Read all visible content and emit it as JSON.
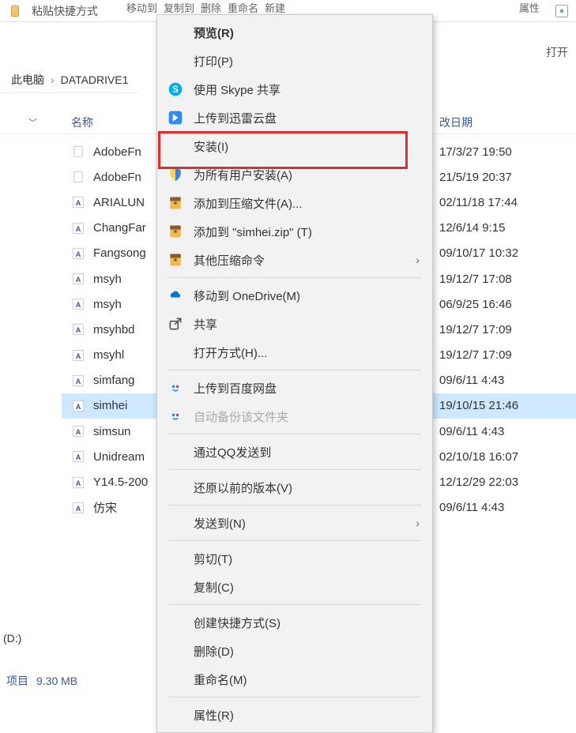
{
  "toolbar": {
    "paste_shortcut": "粘贴快捷方式",
    "move_to": "移动到",
    "copy_to": "复制到",
    "delete": "删除",
    "rename": "重命名",
    "new": "新建",
    "properties": "属性",
    "open": "打开"
  },
  "breadcrumb": {
    "this_pc": "此电脑",
    "drive": "DATADRIVE1"
  },
  "columns": {
    "name": "名称",
    "date": "改日期"
  },
  "sidebar": {
    "drive_label": "(D:)"
  },
  "files": [
    {
      "name": "AdobeFn",
      "date": "17/3/27 19:50",
      "type": "generic"
    },
    {
      "name": "AdobeFn",
      "date": "21/5/19 20:37",
      "type": "generic"
    },
    {
      "name": "ARIALUN",
      "date": "02/11/18 17:44",
      "type": "font"
    },
    {
      "name": "ChangFar",
      "date": "12/6/14 9:15",
      "type": "font"
    },
    {
      "name": "Fangsong",
      "date": "09/10/17 10:32",
      "type": "font"
    },
    {
      "name": "msyh",
      "date": "19/12/7 17:08",
      "type": "font"
    },
    {
      "name": "msyh",
      "date": "06/9/25 16:46",
      "type": "font"
    },
    {
      "name": "msyhbd",
      "date": "19/12/7 17:09",
      "type": "font"
    },
    {
      "name": "msyhl",
      "date": "19/12/7 17:09",
      "type": "font"
    },
    {
      "name": "simfang",
      "date": "09/6/11 4:43",
      "type": "font"
    },
    {
      "name": "simhei",
      "date": "19/10/15 21:46",
      "type": "font",
      "selected": true
    },
    {
      "name": "simsun",
      "date": "09/6/11 4:43",
      "type": "font"
    },
    {
      "name": "Unidream",
      "date": "02/10/18 16:07",
      "type": "font"
    },
    {
      "name": "Y14.5-200",
      "date": "12/12/29 22:03",
      "type": "font"
    },
    {
      "name": "仿宋",
      "date": "09/6/11 4:43",
      "type": "font"
    }
  ],
  "menu": {
    "items": [
      {
        "label": "预览(R)",
        "icon": "",
        "bold": true
      },
      {
        "label": "打印(P)",
        "icon": ""
      },
      {
        "label": "使用 Skype 共享",
        "icon": "skype"
      },
      {
        "label": "上传到迅雷云盘",
        "icon": "xunlei"
      },
      {
        "label": "安装(I)",
        "icon": ""
      },
      {
        "label": "为所有用户安装(A)",
        "icon": "shield"
      },
      {
        "label": "添加到压缩文件(A)...",
        "icon": "archive"
      },
      {
        "label": "添加到 \"simhei.zip\" (T)",
        "icon": "archive"
      },
      {
        "label": "其他压缩命令",
        "icon": "archive",
        "submenu": true
      },
      {
        "sep": true
      },
      {
        "label": "移动到 OneDrive(M)",
        "icon": "onedrive"
      },
      {
        "label": "共享",
        "icon": "share"
      },
      {
        "label": "打开方式(H)...",
        "icon": ""
      },
      {
        "sep": true
      },
      {
        "label": "上传到百度网盘",
        "icon": "baidu"
      },
      {
        "label": "自动备份该文件夹",
        "icon": "baidu",
        "disabled": true
      },
      {
        "sep": true
      },
      {
        "label": "通过QQ发送到",
        "icon": ""
      },
      {
        "sep": true
      },
      {
        "label": "还原以前的版本(V)",
        "icon": ""
      },
      {
        "sep": true
      },
      {
        "label": "发送到(N)",
        "icon": "",
        "submenu": true
      },
      {
        "sep": true
      },
      {
        "label": "剪切(T)",
        "icon": ""
      },
      {
        "label": "复制(C)",
        "icon": ""
      },
      {
        "sep": true
      },
      {
        "label": "创建快捷方式(S)",
        "icon": ""
      },
      {
        "label": "删除(D)",
        "icon": ""
      },
      {
        "label": "重命名(M)",
        "icon": ""
      },
      {
        "sep": true
      },
      {
        "label": "属性(R)",
        "icon": ""
      }
    ]
  },
  "status": {
    "items_sel": "项目",
    "size": "9.30 MB"
  }
}
